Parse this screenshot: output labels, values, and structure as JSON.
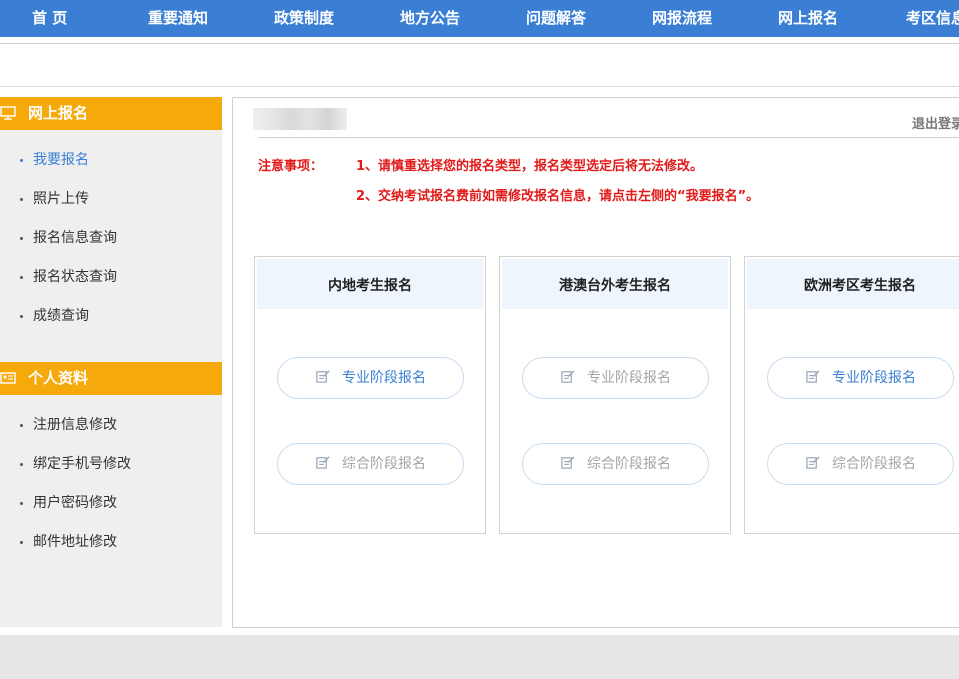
{
  "nav": {
    "items": [
      "首 页",
      "重要通知",
      "政策制度",
      "地方公告",
      "问题解答",
      "网报流程",
      "网上报名",
      "考区信息"
    ]
  },
  "sidebar": {
    "section1": {
      "title": "网上报名",
      "icon": "monitor-icon",
      "items": [
        "我要报名",
        "照片上传",
        "报名信息查询",
        "报名状态查询",
        "成绩查询"
      ]
    },
    "section2": {
      "title": "个人资料",
      "icon": "id-card-icon",
      "items": [
        "注册信息修改",
        "绑定手机号修改",
        "用户密码修改",
        "邮件地址修改"
      ]
    }
  },
  "main": {
    "logout_label": "退出登录",
    "notice": {
      "label": "注意事项：",
      "lines": [
        "1、请慎重选择您的报名类型，报名类型选定后将无法修改。",
        "2、交纳考试报名费前如需修改报名信息，请点击左侧的“我要报名”。"
      ]
    },
    "cards": [
      {
        "title": "内地考生报名",
        "buttons": [
          {
            "label": "专业阶段报名",
            "state": "enabled"
          },
          {
            "label": "综合阶段报名",
            "state": "disabled"
          }
        ]
      },
      {
        "title": "港澳台外考生报名",
        "buttons": [
          {
            "label": "专业阶段报名",
            "state": "disabled"
          },
          {
            "label": "综合阶段报名",
            "state": "disabled"
          }
        ]
      },
      {
        "title": "欧洲考区考生报名",
        "buttons": [
          {
            "label": "专业阶段报名",
            "state": "enabled"
          },
          {
            "label": "综合阶段报名",
            "state": "disabled"
          }
        ]
      }
    ]
  },
  "colors": {
    "nav_bg": "#3a7fd4",
    "sidebar_header": "#f5a90a",
    "notice": "#e21a1a",
    "active_link": "#3a7fd4",
    "card_head_bg": "#eef5fd"
  }
}
